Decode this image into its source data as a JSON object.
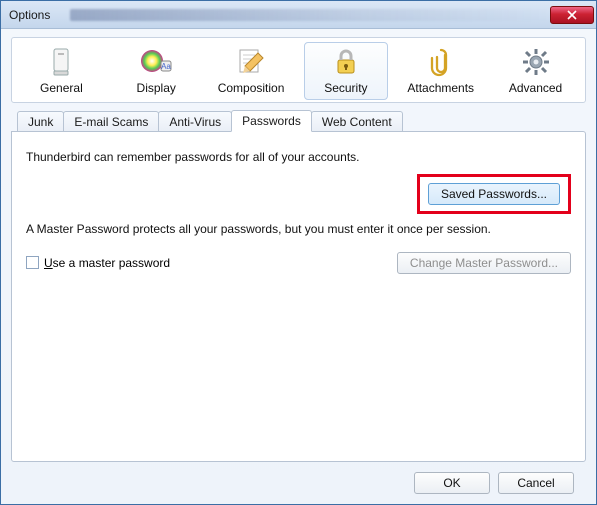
{
  "window": {
    "title": "Options"
  },
  "categories": {
    "general": "General",
    "display": "Display",
    "composition": "Composition",
    "security": "Security",
    "attachments": "Attachments",
    "advanced": "Advanced"
  },
  "tabs": {
    "junk": "Junk",
    "scams": "E-mail Scams",
    "antivirus": "Anti-Virus",
    "passwords": "Passwords",
    "webcontent": "Web Content"
  },
  "panel": {
    "remember_text": "Thunderbird can remember passwords for all of your accounts.",
    "saved_passwords_btn": "Saved Passwords...",
    "master_text": "A Master Password protects all your passwords, but you must enter it once per session.",
    "use_master_prefix": "U",
    "use_master_rest": "se a master password",
    "change_master_btn": "Change Master Password..."
  },
  "footer": {
    "ok": "OK",
    "cancel": "Cancel"
  }
}
